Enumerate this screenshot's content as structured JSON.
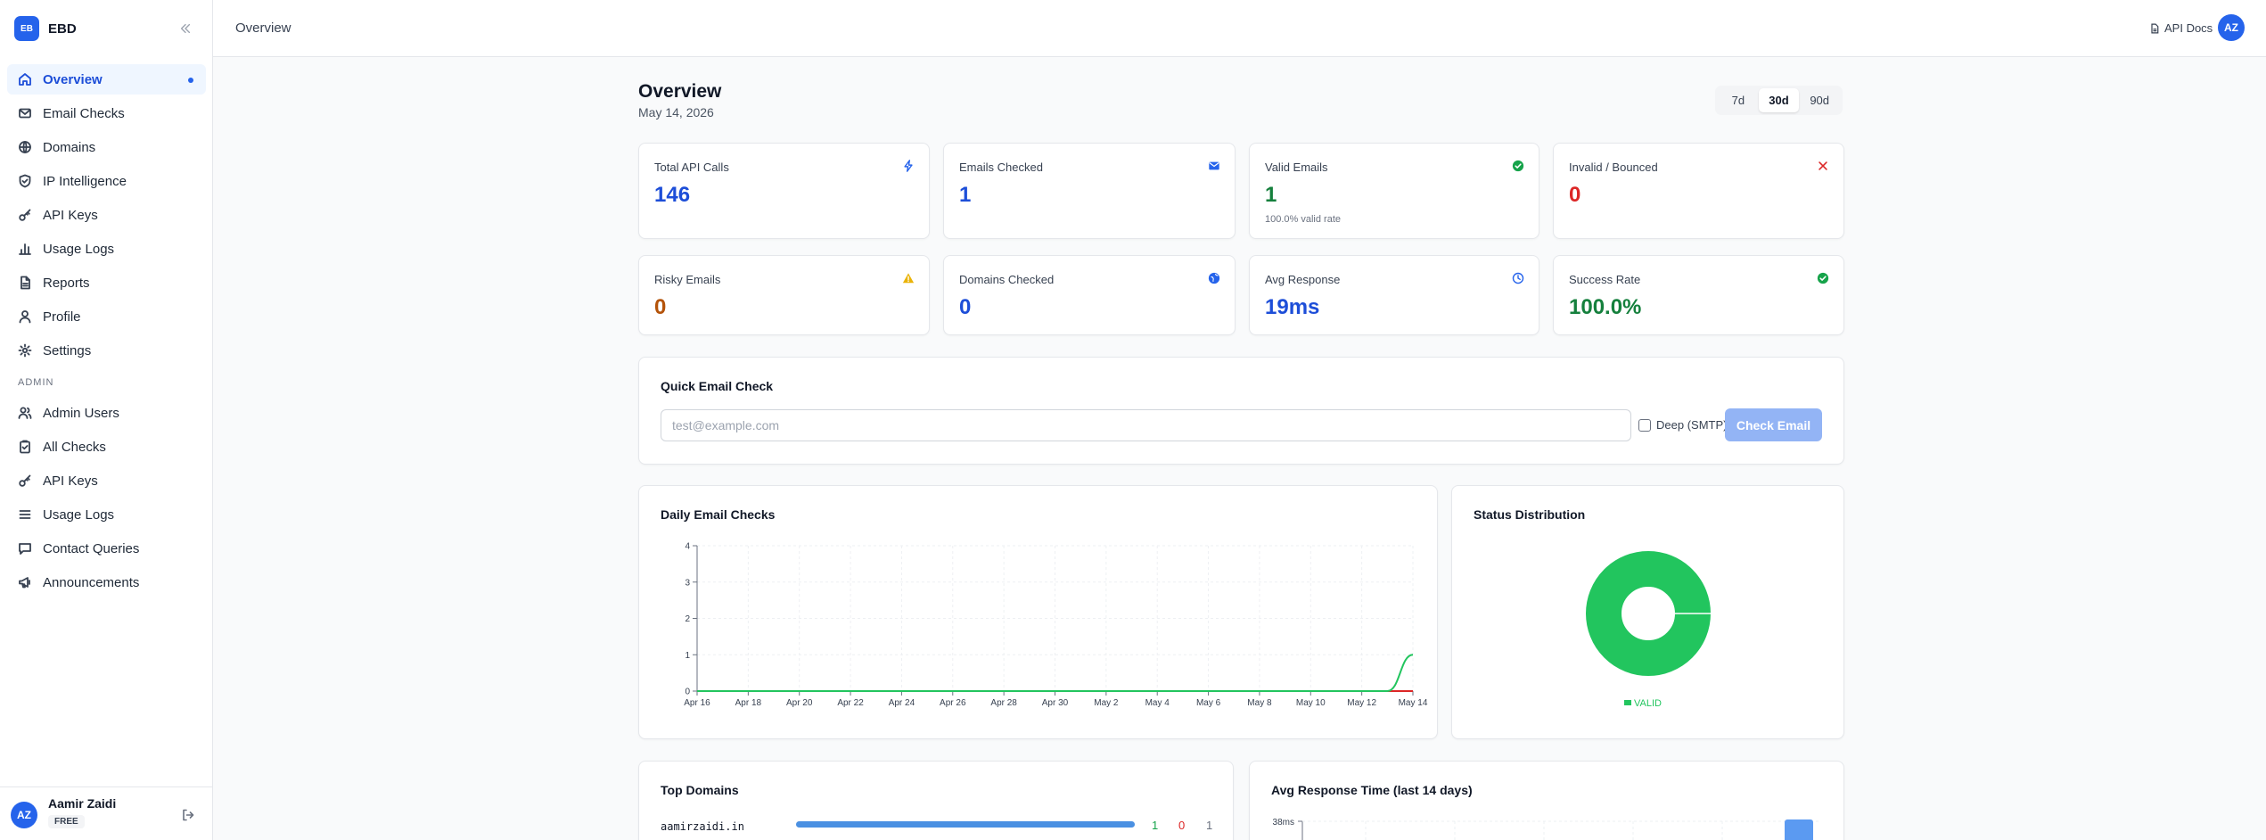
{
  "brand": {
    "logo": "EB",
    "name": "EBD"
  },
  "nav": {
    "main": [
      {
        "label": "Overview",
        "icon": "home-icon",
        "active": true
      },
      {
        "label": "Email Checks",
        "icon": "mail-icon"
      },
      {
        "label": "Domains",
        "icon": "globe-icon"
      },
      {
        "label": "IP Intelligence",
        "icon": "shield-icon"
      },
      {
        "label": "API Keys",
        "icon": "key-icon"
      },
      {
        "label": "Usage Logs",
        "icon": "bar-chart-icon"
      },
      {
        "label": "Reports",
        "icon": "file-icon"
      },
      {
        "label": "Profile",
        "icon": "user-icon"
      },
      {
        "label": "Settings",
        "icon": "gear-icon"
      }
    ],
    "admin_label": "ADMIN",
    "admin": [
      {
        "label": "Admin Users",
        "icon": "users-icon"
      },
      {
        "label": "All Checks",
        "icon": "clipboard-icon"
      },
      {
        "label": "API Keys",
        "icon": "key-icon"
      },
      {
        "label": "Usage Logs",
        "icon": "list-icon"
      },
      {
        "label": "Contact Queries",
        "icon": "message-icon"
      },
      {
        "label": "Announcements",
        "icon": "megaphone-icon"
      }
    ]
  },
  "user": {
    "initials": "AZ",
    "name": "Aamir Zaidi",
    "plan": "FREE"
  },
  "topbar": {
    "breadcrumb": "Overview",
    "api_docs": "API Docs",
    "initials": "AZ"
  },
  "header": {
    "title": "Overview",
    "date": "May 14, 2026",
    "ranges": [
      "7d",
      "30d",
      "90d"
    ],
    "active_range": "30d"
  },
  "stats": [
    {
      "label": "Total API Calls",
      "value": "146",
      "color": "#1d4ed8",
      "icon": "bolt-icon"
    },
    {
      "label": "Emails Checked",
      "value": "1",
      "color": "#1d4ed8",
      "icon": "mail-icon"
    },
    {
      "label": "Valid Emails",
      "value": "1",
      "color": "#15803d",
      "icon": "check-circle-icon",
      "sub": "100.0% valid rate"
    },
    {
      "label": "Invalid / Bounced",
      "value": "0",
      "color": "#dc2626",
      "icon": "x-icon"
    },
    {
      "label": "Risky Emails",
      "value": "0",
      "color": "#b45309",
      "icon": "warning-icon"
    },
    {
      "label": "Domains Checked",
      "value": "0",
      "color": "#1d4ed8",
      "icon": "globe-icon"
    },
    {
      "label": "Avg Response",
      "value": "19ms",
      "color": "#1d4ed8",
      "icon": "clock-icon"
    },
    {
      "label": "Success Rate",
      "value": "100.0%",
      "color": "#15803d",
      "icon": "check-circle-icon"
    }
  ],
  "quick_check": {
    "title": "Quick Email Check",
    "placeholder": "test@example.com",
    "value": "",
    "deep_label": "Deep (SMTP)",
    "button": "Check Email"
  },
  "colors": {
    "valid": "#22c55e",
    "invalid": "#dc2626",
    "accent": "#2563eb",
    "bar": "#4a90e2"
  },
  "daily_checks": {
    "title": "Daily Email Checks",
    "chart_data": {
      "type": "line",
      "x": [
        "Apr 16",
        "Apr 17",
        "Apr 18",
        "Apr 19",
        "Apr 20",
        "Apr 21",
        "Apr 22",
        "Apr 23",
        "Apr 24",
        "Apr 25",
        "Apr 26",
        "Apr 27",
        "Apr 28",
        "Apr 29",
        "Apr 30",
        "May 1",
        "May 2",
        "May 3",
        "May 4",
        "May 5",
        "May 6",
        "May 7",
        "May 8",
        "May 9",
        "May 10",
        "May 11",
        "May 12",
        "May 13",
        "May 14"
      ],
      "tick_labels": [
        "Apr 16",
        "Apr 18",
        "Apr 20",
        "Apr 22",
        "Apr 24",
        "Apr 26",
        "Apr 28",
        "Apr 30",
        "May 2",
        "May 4",
        "May 6",
        "May 8",
        "May 10",
        "May 12",
        "May 14"
      ],
      "series": [
        {
          "values": [
            0,
            0,
            0,
            0,
            0,
            0,
            0,
            0,
            0,
            0,
            0,
            0,
            0,
            0,
            0,
            0,
            0,
            0,
            0,
            0,
            0,
            0,
            0,
            0,
            0,
            0,
            0,
            0,
            1
          ],
          "color": "#22c55e"
        },
        {
          "values": [
            0,
            0,
            0,
            0,
            0,
            0,
            0,
            0,
            0,
            0,
            0,
            0,
            0,
            0,
            0,
            0,
            0,
            0,
            0,
            0,
            0,
            0,
            0,
            0,
            0,
            0,
            0,
            0,
            0
          ],
          "color": "#dc2626"
        }
      ],
      "yticks": [
        0,
        1,
        2,
        3,
        4
      ],
      "ylim": [
        0,
        4
      ],
      "grid": true
    }
  },
  "status_distribution": {
    "title": "Status Distribution",
    "chart_data": {
      "type": "pie",
      "labels": [
        "VALID"
      ],
      "values": [
        1
      ],
      "colors": [
        "#22c55e"
      ],
      "legend": "bottom"
    }
  },
  "top_domains": {
    "title": "Top Domains",
    "rows": [
      {
        "domain": "aamirzaidi.in",
        "share": 1.0,
        "valid": "1",
        "invalid": "0",
        "total": "1"
      }
    ]
  },
  "avg_response": {
    "title": "Avg Response Time (last 14 days)",
    "chart_data": {
      "type": "bar",
      "ytick_top": "38ms",
      "ymax": 38,
      "values": [
        38
      ]
    }
  }
}
